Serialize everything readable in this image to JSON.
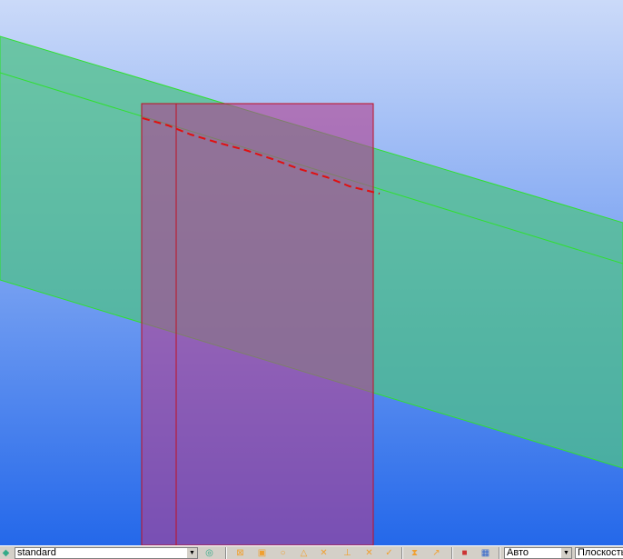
{
  "toolbar": {
    "style_combo": "standard",
    "mode_combo": "Авто",
    "plane_combo": "Плоскость"
  },
  "colors": {
    "sky_top": "#cbdaf9",
    "sky_bottom": "#2468ea",
    "band": "#5fc09a",
    "rect": "#b0508f",
    "curve": "#e01010"
  }
}
